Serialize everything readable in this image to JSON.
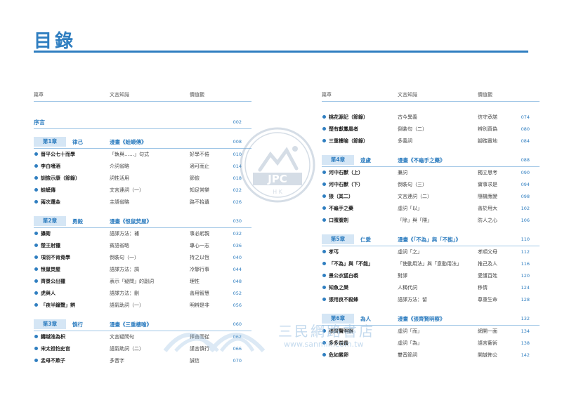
{
  "title": "目錄",
  "header": {
    "c1": "篇章",
    "c2": "文言知識",
    "c3": "價值觀"
  },
  "preface": {
    "label": "序言",
    "page": "002"
  },
  "left_chapters": [
    {
      "badge": "第1章",
      "name": "律己",
      "comic": "漫畫《蛙蟆傳》",
      "page": "008",
      "rows": [
        {
          "t": "晉平公七十而學",
          "k": "「執與……」句式",
          "v": "好學不倦",
          "p": "010"
        },
        {
          "t": "李白嗜酒",
          "k": "介詞省略",
          "v": "適可而止",
          "p": "014"
        },
        {
          "t": "訓儉示康（節錄）",
          "k": "詞性活用",
          "v": "節儉",
          "p": "018"
        },
        {
          "t": "蛙蟆傳",
          "k": "文言連詞（一）",
          "v": "知足常樂",
          "p": "022"
        },
        {
          "t": "兩次還金",
          "k": "主語省略",
          "v": "路不拾遺",
          "p": "026"
        }
      ]
    },
    {
      "badge": "第2章",
      "name": "勇毅",
      "comic": "漫畫《恨鼠焚屋》",
      "page": "030",
      "rows": [
        {
          "t": "攝衛",
          "k": "語譯方法：補",
          "v": "事必躬親",
          "p": "032"
        },
        {
          "t": "楚王射獵",
          "k": "賓語省略",
          "v": "專心一志",
          "p": "036"
        },
        {
          "t": "項羽不肯竟學",
          "k": "倒裝句（一）",
          "v": "持之以恆",
          "p": "040"
        },
        {
          "t": "恨鼠焚屋",
          "k": "語譯方法：調",
          "v": "冷靜行事",
          "p": "044"
        },
        {
          "t": "齊景公出獵",
          "k": "表示「疑問」的副詞",
          "v": "理性",
          "p": "048"
        },
        {
          "t": "虎與人",
          "k": "語譯方法：刪",
          "v": "善用智慧",
          "p": "052"
        },
        {
          "t": "「夜半鐘聲」辨",
          "k": "語氣助詞（一）",
          "v": "明辨是非",
          "p": "056"
        }
      ]
    },
    {
      "badge": "第3章",
      "name": "慎行",
      "comic": "漫畫《三重樓喻》",
      "page": "060",
      "rows": [
        {
          "t": "鑄越淮為枳",
          "k": "文言疑問句",
          "v": "擇善而從",
          "p": "062"
        },
        {
          "t": "宋太祖怕史官",
          "k": "語氣助詞（二）",
          "v": "謹言慎行",
          "p": "066"
        },
        {
          "t": "孟母不欺子",
          "k": "多音字",
          "v": "誠信",
          "p": "070"
        }
      ]
    }
  ],
  "right_top_rows": [
    {
      "t": "桃花源記（節錄）",
      "k": "古今異義",
      "v": "信守承諾",
      "p": "074"
    },
    {
      "t": "楚有獻鳳凰者",
      "k": "倒裝句（二）",
      "v": "辨別真偽",
      "p": "080"
    },
    {
      "t": "三重樓喻（節錄）",
      "k": "多義詞",
      "v": "腳踏實地",
      "p": "084"
    }
  ],
  "right_chapters": [
    {
      "badge": "第4章",
      "name": "遠慮",
      "comic": "漫畫《不龜手之藥》",
      "page": "088",
      "rows": [
        {
          "t": "河中石獸（上）",
          "k": "兼詞",
          "v": "獨立思考",
          "p": "090"
        },
        {
          "t": "河中石獸（下）",
          "k": "倒裝句（三）",
          "v": "實事求是",
          "p": "094"
        },
        {
          "t": "狼（其二）",
          "k": "文言連詞（二）",
          "v": "隨機應變",
          "p": "098"
        },
        {
          "t": "不龜手之藥",
          "k": "虛詞「以」",
          "v": "善於用大",
          "p": "102"
        },
        {
          "t": "口蜜腹劍",
          "k": "「除」與「隱」",
          "v": "防人之心",
          "p": "106"
        }
      ]
    },
    {
      "badge": "第5章",
      "name": "仁愛",
      "comic": "漫畫《「不為」與「不能」》",
      "page": "110",
      "rows": [
        {
          "t": "孝丐",
          "k": "虛詞「之」",
          "v": "孝順父母",
          "p": "112"
        },
        {
          "t": "「不為」與「不能」",
          "k": "「使動用法」與「意動用法」",
          "v": "推己及人",
          "p": "116"
        },
        {
          "t": "景公衣狐白裘",
          "k": "對譯",
          "v": "愛護百姓",
          "p": "120"
        },
        {
          "t": "知魚之樂",
          "k": "人稱代詞",
          "v": "移情",
          "p": "124"
        },
        {
          "t": "張用良不殺蜂",
          "k": "語譯方法：留",
          "v": "尊重生命",
          "p": "128"
        }
      ]
    },
    {
      "badge": "第6章",
      "name": "為人",
      "comic": "漫畫《張齊賢明察》",
      "page": "132",
      "rows": [
        {
          "t": "張齊賢明察",
          "k": "虛詞「而」",
          "v": "網開一面",
          "p": "134"
        },
        {
          "t": "多多益善",
          "k": "虛詞「為」",
          "v": "語言藝術",
          "p": "138"
        },
        {
          "t": "危如累卵",
          "k": "雙音節詞",
          "v": "開誠佈公",
          "p": "142"
        }
      ]
    }
  ],
  "watermark": {
    "logo_text": "JPC",
    "logo_sub": "H K",
    "store": "三民網路書店",
    "url": "www.sanmin.com.tw"
  },
  "colors": {
    "accent": "#2f7ec0",
    "badge_bg": "#d5e6f5",
    "rule": "#9fc6e6"
  }
}
